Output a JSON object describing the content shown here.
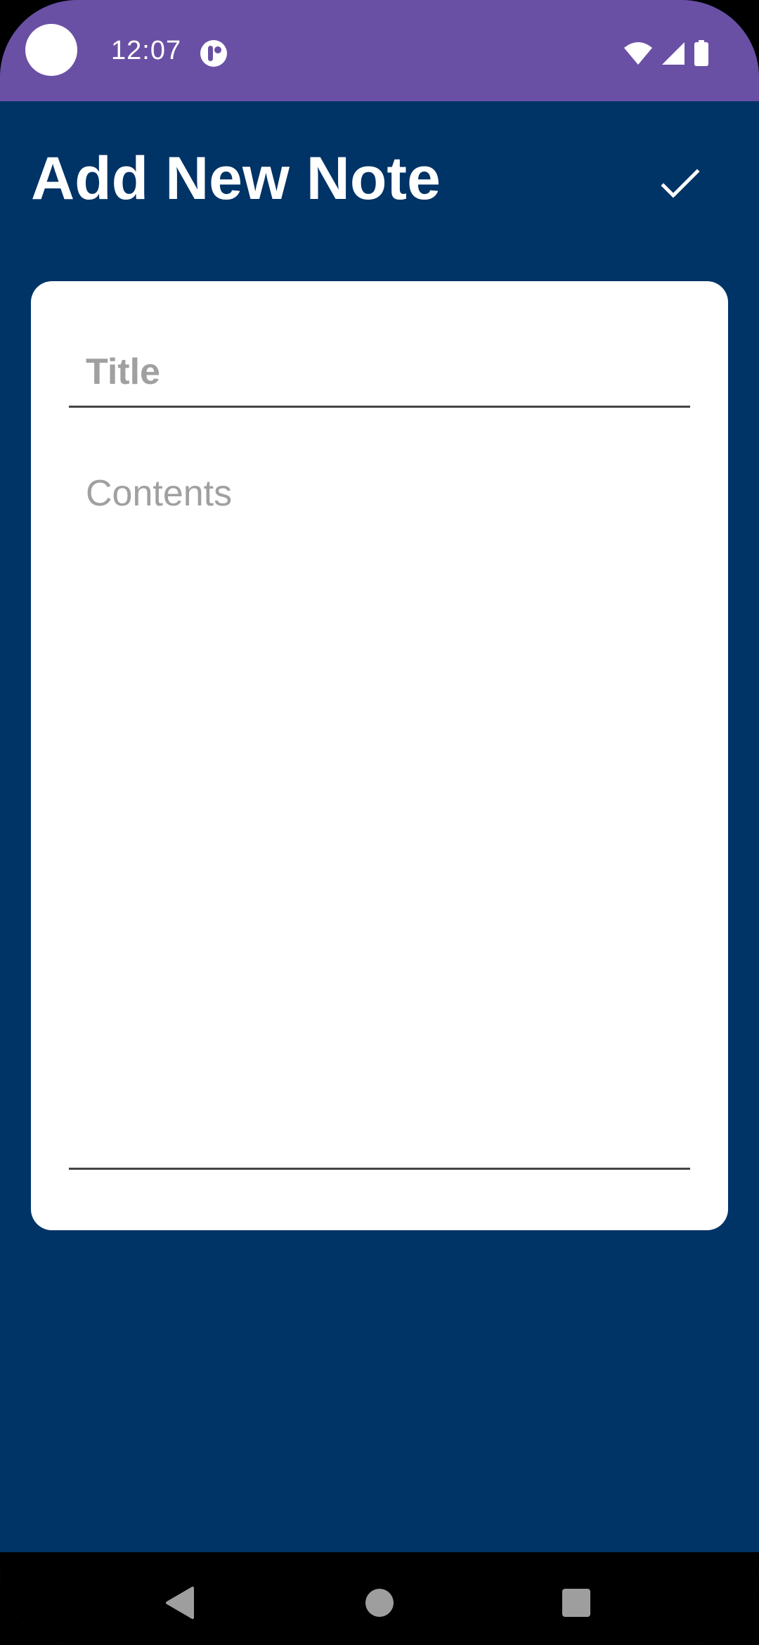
{
  "status_bar": {
    "time": "12:07",
    "icons": [
      "camera-dot",
      "app-notification-icon",
      "wifi-icon",
      "signal-icon",
      "battery-icon"
    ]
  },
  "app_bar": {
    "title": "Add New Note",
    "save_icon": "check-icon"
  },
  "form": {
    "title_placeholder": "Title",
    "title_value": "",
    "contents_placeholder": "Contents",
    "contents_value": ""
  },
  "nav_bar": {
    "icons": [
      "back-icon",
      "home-icon",
      "recents-icon"
    ]
  },
  "colors": {
    "status_bar": "#6a50a4",
    "background": "#003366",
    "card": "#ffffff",
    "placeholder": "#a0a0a0",
    "nav_bar": "#000000"
  }
}
